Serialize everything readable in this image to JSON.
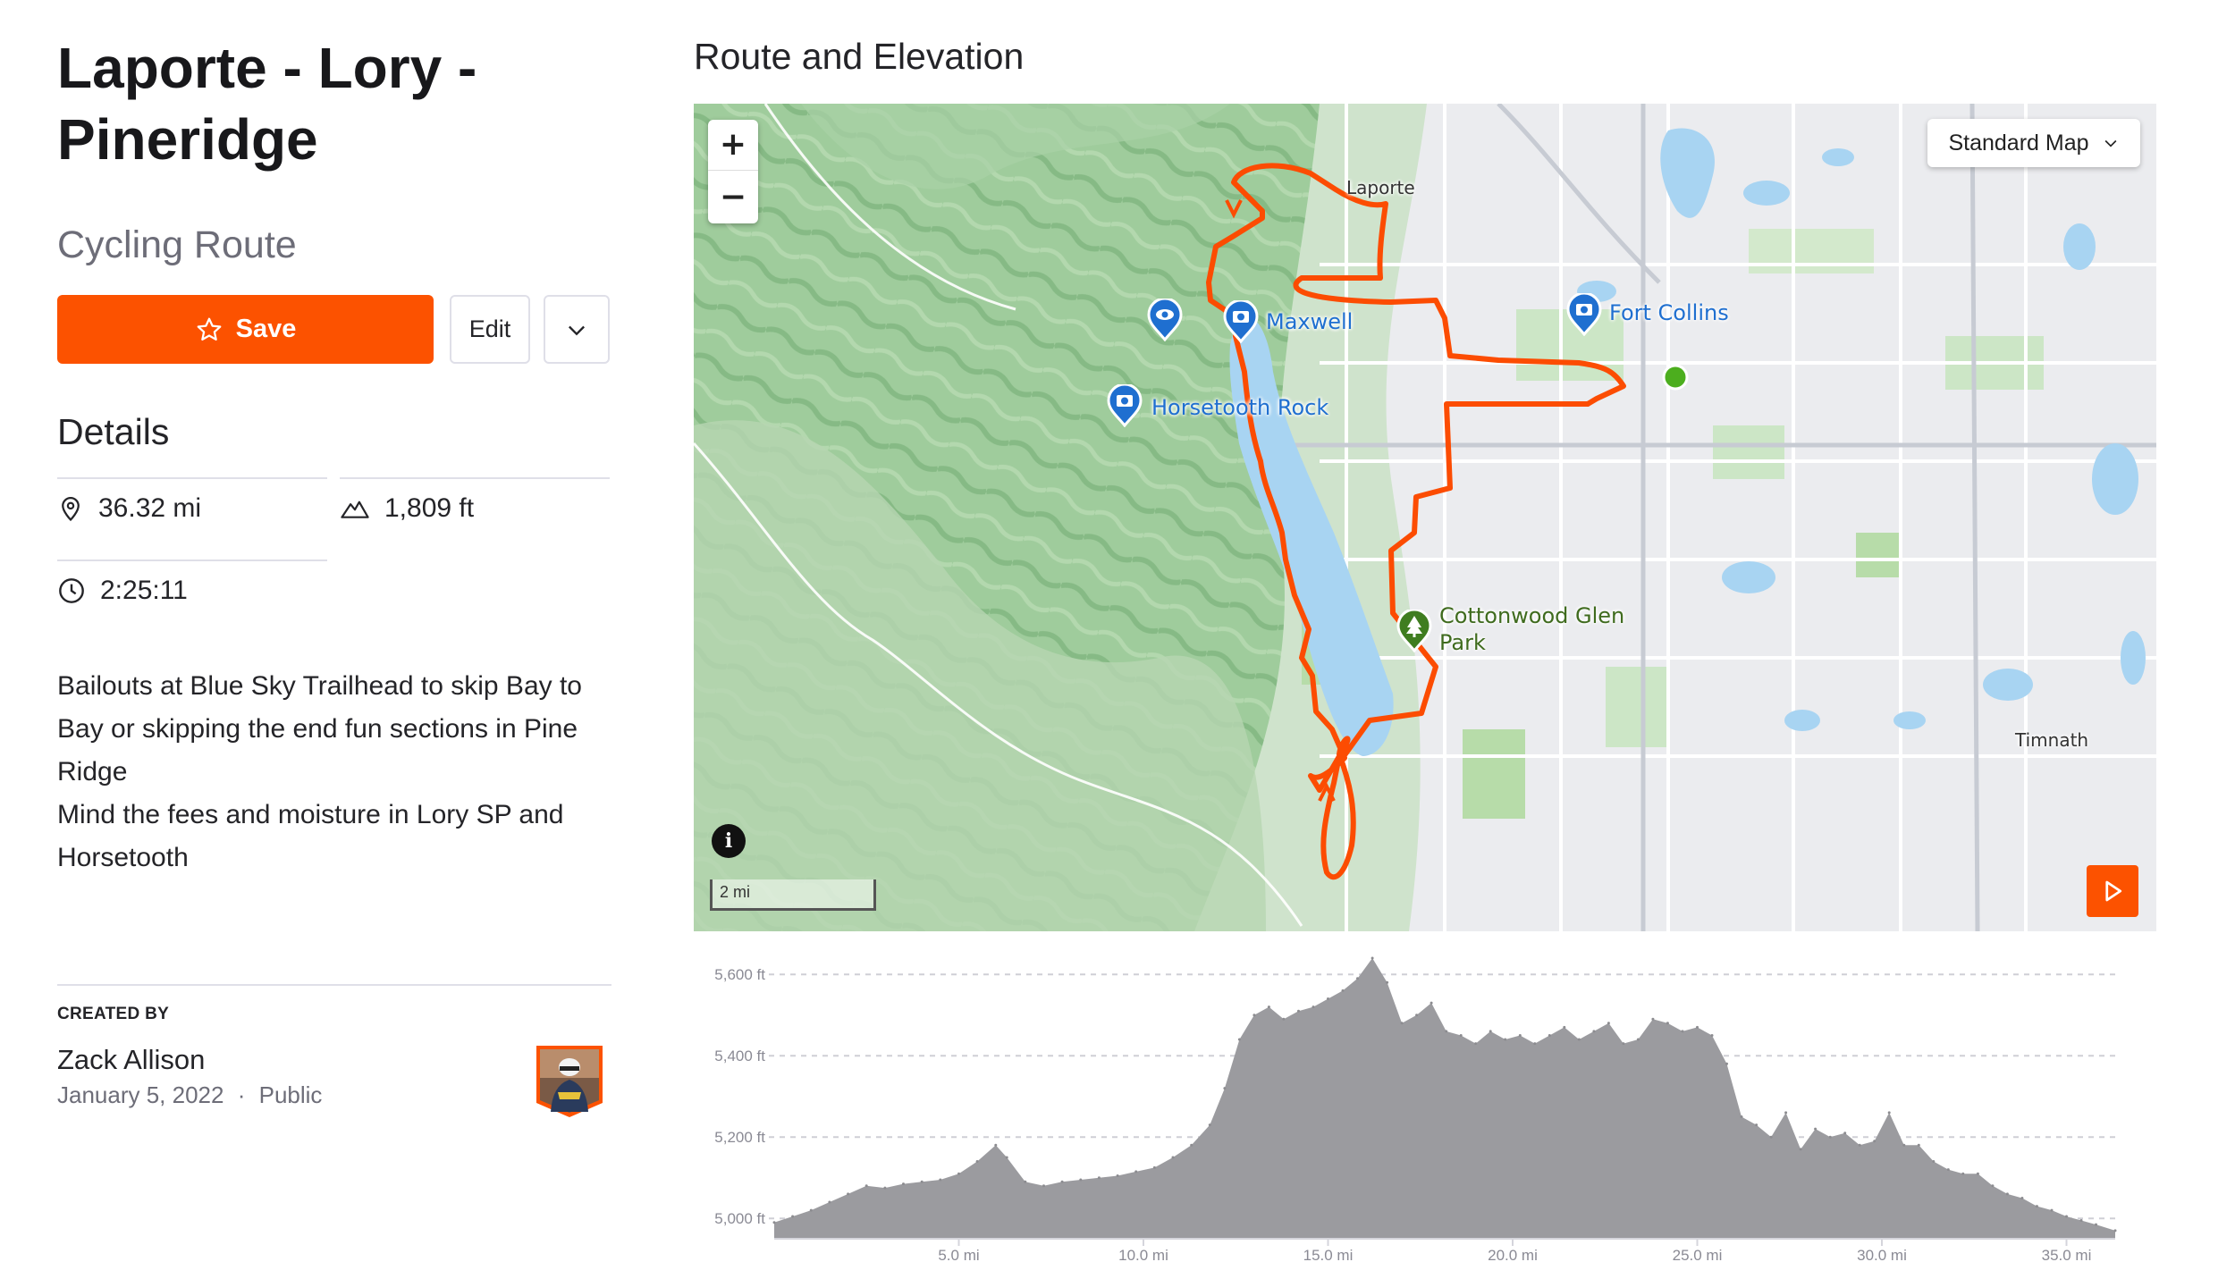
{
  "route": {
    "title": "Laporte - Lory - Pineridge",
    "type": "Cycling Route"
  },
  "actions": {
    "save_label": "Save",
    "edit_label": "Edit"
  },
  "details": {
    "heading": "Details",
    "distance": "36.32 mi",
    "elevation_gain": "1,809 ft",
    "moving_time": "2:25:11",
    "description": [
      "Bailouts at Blue Sky Trailhead to skip Bay to Bay or skipping the end fun sections in Pine Ridge",
      "Mind the fees and moisture in Lory SP and Horsetooth"
    ]
  },
  "creator": {
    "label": "CREATED BY",
    "name": "Zack Allison",
    "date": "January 5, 2022",
    "separator": "·",
    "visibility": "Public"
  },
  "map": {
    "section_title": "Route and Elevation",
    "style_selector": "Standard Map",
    "scale_label": "2 mi",
    "labels": {
      "laporte": "Laporte",
      "fort_collins": "Fort Collins",
      "maxwell": "Maxwell",
      "horsetooth_rock": "Horsetooth Rock",
      "cottonwood_line1": "Cottonwood Glen",
      "cottonwood_line2": "Park",
      "timnath": "Timnath"
    },
    "colors": {
      "route": "#fc4c02",
      "start_marker": "#4cae1e",
      "poi": "#1f6fd0",
      "water": "#a8d4f2"
    },
    "icons": [
      "zoom-in-icon",
      "zoom-out-icon",
      "chevron-down-icon",
      "info-icon",
      "play-icon",
      "camera-icon",
      "eye-icon",
      "tree-icon"
    ]
  },
  "chart_data": {
    "type": "area",
    "title": "",
    "xlabel": "",
    "ylabel": "",
    "x_unit": "mi",
    "y_unit": "ft",
    "xlim": [
      0,
      36.32
    ],
    "ylim": [
      4950,
      5640
    ],
    "y_ticks": [
      "5,000 ft",
      "5,200 ft",
      "5,400 ft",
      "5,600 ft"
    ],
    "y_tick_values": [
      5000,
      5200,
      5400,
      5600
    ],
    "x_ticks": [
      "5.0 mi",
      "10.0 mi",
      "15.0 mi",
      "20.0 mi",
      "25.0 mi",
      "30.0 mi",
      "35.0 mi"
    ],
    "x_tick_values": [
      5,
      10,
      15,
      20,
      25,
      30,
      35
    ],
    "x": [
      0,
      0.5,
      1,
      1.5,
      2,
      2.5,
      3,
      3.5,
      4,
      4.5,
      5,
      5.5,
      6,
      6.3,
      6.8,
      7.3,
      7.8,
      8.3,
      8.8,
      9.3,
      9.8,
      10.3,
      10.8,
      11.3,
      11.8,
      12.2,
      12.6,
      13,
      13.4,
      13.8,
      14.2,
      14.6,
      15,
      15.4,
      15.8,
      16.2,
      16.6,
      17,
      17.4,
      17.8,
      18.2,
      18.6,
      19,
      19.4,
      19.8,
      20.2,
      20.6,
      21,
      21.4,
      21.8,
      22.2,
      22.6,
      23,
      23.4,
      23.8,
      24.2,
      24.6,
      25,
      25.4,
      25.8,
      26.2,
      26.6,
      27,
      27.4,
      27.8,
      28.2,
      28.6,
      29,
      29.4,
      29.8,
      30.2,
      30.6,
      31,
      31.4,
      31.8,
      32.2,
      32.6,
      33,
      33.4,
      33.8,
      34.2,
      34.6,
      35,
      35.4,
      35.8,
      36.32
    ],
    "values": [
      4990,
      5005,
      5020,
      5040,
      5060,
      5080,
      5075,
      5085,
      5090,
      5095,
      5110,
      5140,
      5180,
      5150,
      5090,
      5080,
      5090,
      5095,
      5100,
      5105,
      5115,
      5125,
      5150,
      5180,
      5230,
      5320,
      5440,
      5500,
      5520,
      5490,
      5510,
      5520,
      5540,
      5560,
      5590,
      5640,
      5580,
      5480,
      5500,
      5530,
      5460,
      5450,
      5430,
      5460,
      5440,
      5450,
      5430,
      5450,
      5470,
      5440,
      5460,
      5480,
      5430,
      5440,
      5490,
      5480,
      5460,
      5470,
      5450,
      5380,
      5250,
      5230,
      5200,
      5260,
      5170,
      5220,
      5200,
      5210,
      5180,
      5190,
      5260,
      5180,
      5180,
      5140,
      5120,
      5110,
      5110,
      5080,
      5060,
      5050,
      5030,
      5020,
      5005,
      4995,
      4985,
      4970
    ]
  }
}
